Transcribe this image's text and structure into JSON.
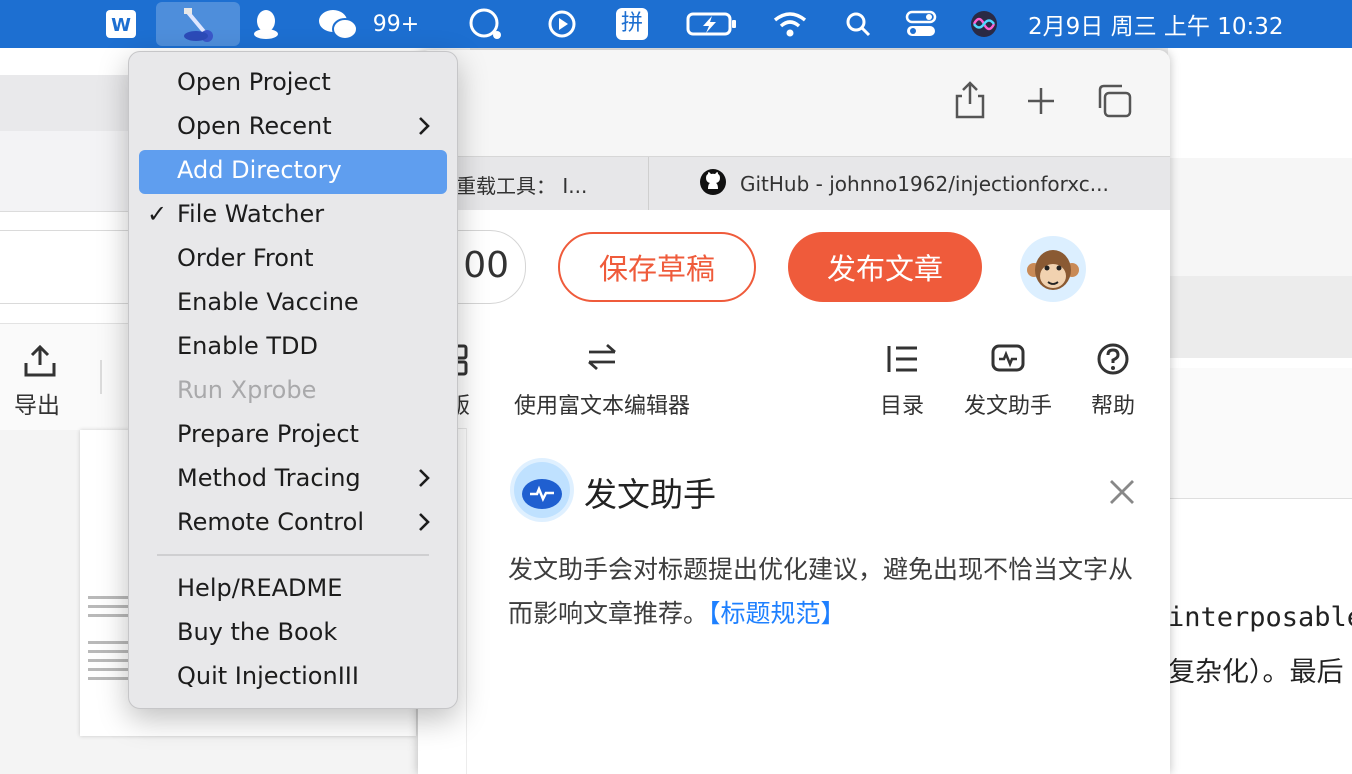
{
  "menubar": {
    "badge": "99+",
    "ime": "拼",
    "clock": "2月9日 周三 上午 10:32"
  },
  "menu": {
    "items": [
      {
        "label": "Open Project",
        "submenu": false,
        "checked": false,
        "disabled": false,
        "selected": false
      },
      {
        "label": "Open Recent",
        "submenu": true,
        "checked": false,
        "disabled": false,
        "selected": false
      },
      {
        "label": "Add Directory",
        "submenu": false,
        "checked": false,
        "disabled": false,
        "selected": true
      },
      {
        "label": "File Watcher",
        "submenu": false,
        "checked": true,
        "disabled": false,
        "selected": false
      },
      {
        "label": "Order Front",
        "submenu": false,
        "checked": false,
        "disabled": false,
        "selected": false
      },
      {
        "label": "Enable Vaccine",
        "submenu": false,
        "checked": false,
        "disabled": false,
        "selected": false
      },
      {
        "label": "Enable TDD",
        "submenu": false,
        "checked": false,
        "disabled": false,
        "selected": false
      },
      {
        "label": "Run Xprobe",
        "submenu": false,
        "checked": false,
        "disabled": true,
        "selected": false
      },
      {
        "label": "Prepare Project",
        "submenu": false,
        "checked": false,
        "disabled": false,
        "selected": false
      },
      {
        "label": "Method Tracing",
        "submenu": true,
        "checked": false,
        "disabled": false,
        "selected": false
      },
      {
        "label": "Remote Control",
        "submenu": true,
        "checked": false,
        "disabled": false,
        "selected": false
      },
      {
        "label": "Help/README",
        "submenu": false,
        "checked": false,
        "disabled": false,
        "selected": false
      },
      {
        "label": "Buy the Book",
        "submenu": false,
        "checked": false,
        "disabled": false,
        "selected": false
      },
      {
        "label": "Quit InjectionIII",
        "submenu": false,
        "checked": false,
        "disabled": false,
        "selected": false
      }
    ],
    "check_mark": "✓"
  },
  "background": {
    "export_label": "导出",
    "code_text": "interposable",
    "cn_text": "复杂化）。最后"
  },
  "browser": {
    "tabs": [
      {
        "label": "重载工具： I..."
      },
      {
        "label": "GitHub - johnno1962/injectionforxc..."
      }
    ],
    "word_count_partial": "00",
    "save_draft": "保存草稿",
    "publish": "发布文章",
    "toolbar": {
      "partial_label": "版",
      "rich_text": "使用富文本编辑器",
      "toc": "目录",
      "assistant": "发文助手",
      "help": "帮助"
    },
    "assistant_panel": {
      "title": "发文助手",
      "body": "发文助手会对标题提出优化建议，避免出现不恰当文字从而影响文章推荐。",
      "link": "【标题规范】"
    }
  },
  "colors": {
    "menubar": "#1d6fd1",
    "menu_selected": "#5f9eef",
    "accent_orange": "#ef5b3b",
    "link_blue": "#1e80ff"
  }
}
